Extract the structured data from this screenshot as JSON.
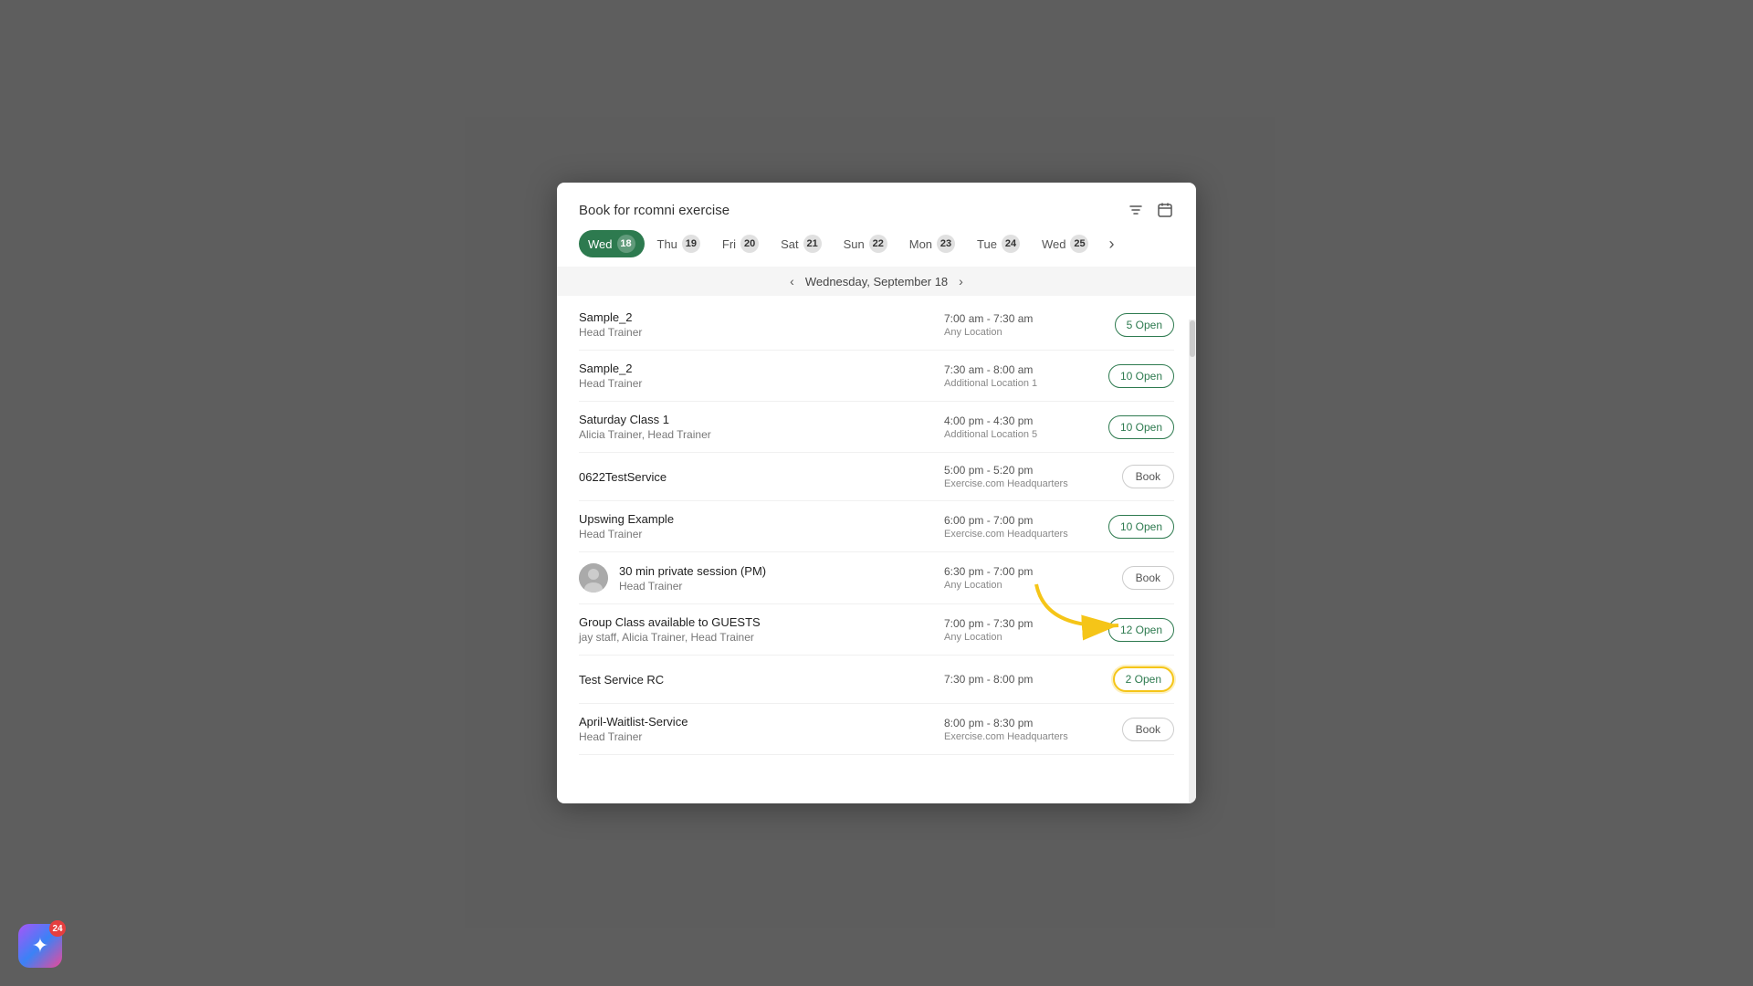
{
  "header": {
    "title": "Book for rcomni exercise",
    "filter_icon": "▼",
    "calendar_icon": "📅"
  },
  "day_tabs": [
    {
      "label": "Wed",
      "num": "18",
      "active": true
    },
    {
      "label": "Thu",
      "num": "19",
      "active": false
    },
    {
      "label": "Fri",
      "num": "20",
      "active": false
    },
    {
      "label": "Sat",
      "num": "21",
      "active": false
    },
    {
      "label": "Sun",
      "num": "22",
      "active": false
    },
    {
      "label": "Mon",
      "num": "23",
      "active": false
    },
    {
      "label": "Tue",
      "num": "24",
      "active": false
    },
    {
      "label": "Wed",
      "num": "25",
      "active": false
    }
  ],
  "date_bar": {
    "date": "Wednesday, September 18",
    "prev_label": "‹",
    "next_label": "›"
  },
  "schedule": [
    {
      "id": 1,
      "name": "Sample_2",
      "trainer": "Head Trainer",
      "time": "7:00 am - 7:30 am",
      "location": "Any Location",
      "action_type": "open",
      "action_label": "5 Open",
      "highlighted": false,
      "has_avatar": false
    },
    {
      "id": 2,
      "name": "Sample_2",
      "trainer": "Head Trainer",
      "time": "7:30 am - 8:00 am",
      "location": "Additional Location 1",
      "action_type": "open",
      "action_label": "10 Open",
      "highlighted": false,
      "has_avatar": false
    },
    {
      "id": 3,
      "name": "Saturday Class 1",
      "trainer": "Alicia Trainer, Head Trainer",
      "time": "4:00 pm - 4:30 pm",
      "location": "Additional Location 5",
      "action_type": "open",
      "action_label": "10 Open",
      "highlighted": false,
      "has_avatar": false
    },
    {
      "id": 4,
      "name": "0622TestService",
      "trainer": "",
      "time": "5:00 pm - 5:20 pm",
      "location": "Exercise.com Headquarters",
      "action_type": "book",
      "action_label": "Book",
      "highlighted": false,
      "has_avatar": false
    },
    {
      "id": 5,
      "name": "Upswing Example",
      "trainer": "Head Trainer",
      "time": "6:00 pm - 7:00 pm",
      "location": "Exercise.com Headquarters",
      "action_type": "open",
      "action_label": "10 Open",
      "highlighted": false,
      "has_avatar": false
    },
    {
      "id": 6,
      "name": "30 min private session (PM)",
      "trainer": "Head Trainer",
      "time": "6:30 pm - 7:00 pm",
      "location": "Any Location",
      "action_type": "book",
      "action_label": "Book",
      "highlighted": false,
      "has_avatar": true
    },
    {
      "id": 7,
      "name": "Group Class available to GUESTS",
      "trainer": "jay staff, Alicia Trainer, Head Trainer",
      "time": "7:00 pm - 7:30 pm",
      "location": "Any Location",
      "action_type": "open",
      "action_label": "12 Open",
      "highlighted": false,
      "has_avatar": false
    },
    {
      "id": 8,
      "name": "Test Service RC",
      "trainer": "",
      "time": "7:30 pm - 8:00 pm",
      "location": "",
      "action_type": "open",
      "action_label": "2 Open",
      "highlighted": true,
      "has_avatar": false
    },
    {
      "id": 9,
      "name": "April-Waitlist-Service",
      "trainer": "Head Trainer",
      "time": "8:00 pm - 8:30 pm",
      "location": "Exercise.com Headquarters",
      "action_type": "book",
      "action_label": "Book",
      "highlighted": false,
      "has_avatar": false
    }
  ],
  "app_icon": {
    "badge": "24"
  }
}
